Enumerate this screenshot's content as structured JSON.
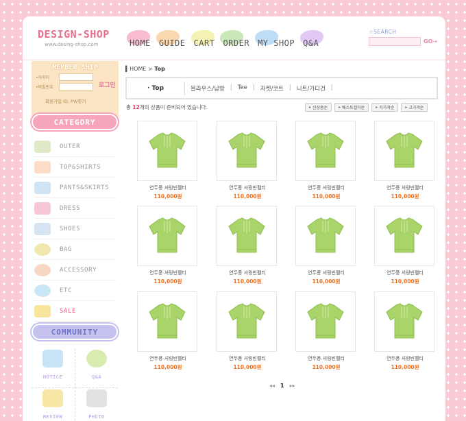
{
  "brand": {
    "title": "DESIGN-SHOP",
    "url": "www.desing-shop.com"
  },
  "gnb": [
    {
      "label": "HOME",
      "color": "#f6a5bd"
    },
    {
      "label": "GUIDE",
      "color": "#f9c995"
    },
    {
      "label": "CART",
      "color": "#f3ee9b"
    },
    {
      "label": "ORDER",
      "color": "#b7e3a0"
    },
    {
      "label": "MY SHOP",
      "color": "#a9d2f3"
    },
    {
      "label": "Q&A",
      "color": "#d8b5ee"
    }
  ],
  "search": {
    "label": "☆SEARCH",
    "go": "GO⇢"
  },
  "member": {
    "title": "MEMBER SHIP",
    "id_label": "•아이디",
    "pw_label": "•비밀번호",
    "login": "로그인",
    "links": "회원가입   ID, PW찾기"
  },
  "category": {
    "title": "CATEGORY",
    "items": [
      {
        "label": "OUTER",
        "icon": "jacket-icon",
        "color": "#dfe9c8"
      },
      {
        "label": "TOP&SHIRTS",
        "icon": "shirt-icon",
        "color": "#fbdcc6"
      },
      {
        "label": "PANTS&SKIRTS",
        "icon": "pants-icon",
        "color": "#cfe3f3"
      },
      {
        "label": "DRESS",
        "icon": "dress-icon",
        "color": "#f9c8d6"
      },
      {
        "label": "SHOES",
        "icon": "shoes-icon",
        "color": "#d6e4f2"
      },
      {
        "label": "BAG",
        "icon": "bag-icon",
        "color": "#f1e8b0"
      },
      {
        "label": "ACCESSORY",
        "icon": "necklace-icon",
        "color": "#f7d7c4"
      },
      {
        "label": "ETC",
        "icon": "hat-icon",
        "color": "#cbe6f5"
      },
      {
        "label": "SALE",
        "icon": "music-note-icon",
        "color": "#f6e59a"
      }
    ]
  },
  "community": {
    "title": "COMMUNITY",
    "items": [
      {
        "label": "NOTICE",
        "icon": "notice-board-icon",
        "color": "#c7e3f6"
      },
      {
        "label": "Q&A",
        "icon": "question-icon",
        "color": "#d8ecb0"
      },
      {
        "label": "REVIEW",
        "icon": "pencil-icon",
        "color": "#f6e7a6"
      },
      {
        "label": "PHOTO",
        "icon": "camera-icon",
        "color": "#e2e2e2"
      }
    ]
  },
  "breadcrumb": {
    "home": "HOME",
    "sep": ">",
    "current": "Top"
  },
  "subcategory": {
    "current": "· Top",
    "links": [
      "블라우스/남방",
      "Tee",
      "자켓/코트",
      "니트/가디건"
    ]
  },
  "count": {
    "prefix": "총",
    "number": "12",
    "suffix": "개의 상품이 준비되어 있습니다."
  },
  "sorts": [
    "신상품순",
    "베스트셀러순",
    "저가격순",
    "고가격순"
  ],
  "products": [
    {
      "name": "연두풍 셔링빈펠티",
      "price": "110,000원"
    },
    {
      "name": "연두풍 셔링빈펠티",
      "price": "110,000원"
    },
    {
      "name": "연두풍 셔링빈펠티",
      "price": "110,000원"
    },
    {
      "name": "연두풍 셔링빈펠티",
      "price": "110,000원"
    },
    {
      "name": "연두풍 셔링빈펠티",
      "price": "110,000원"
    },
    {
      "name": "연두풍 셔링빈펠티",
      "price": "110,000원"
    },
    {
      "name": "연두풍 셔링빈펠티",
      "price": "110,000원"
    },
    {
      "name": "연두풍 셔링빈펠티",
      "price": "110,000원"
    },
    {
      "name": "연두풍 셔링빈펠티",
      "price": "110,000원"
    },
    {
      "name": "연두풍 셔링빈펠티",
      "price": "110,000원"
    },
    {
      "name": "연두풍 셔링빈펠티",
      "price": "110,000원"
    },
    {
      "name": "연두풍 셔링빈펠티",
      "price": "110,000원"
    }
  ],
  "paging": {
    "prev": "◂◂",
    "page": "1",
    "next": "▸▸"
  },
  "colors": {
    "background": "#f9c9d4",
    "accent": "#e86f8d",
    "price": "#f07020",
    "shirt": "#a9d46a"
  }
}
